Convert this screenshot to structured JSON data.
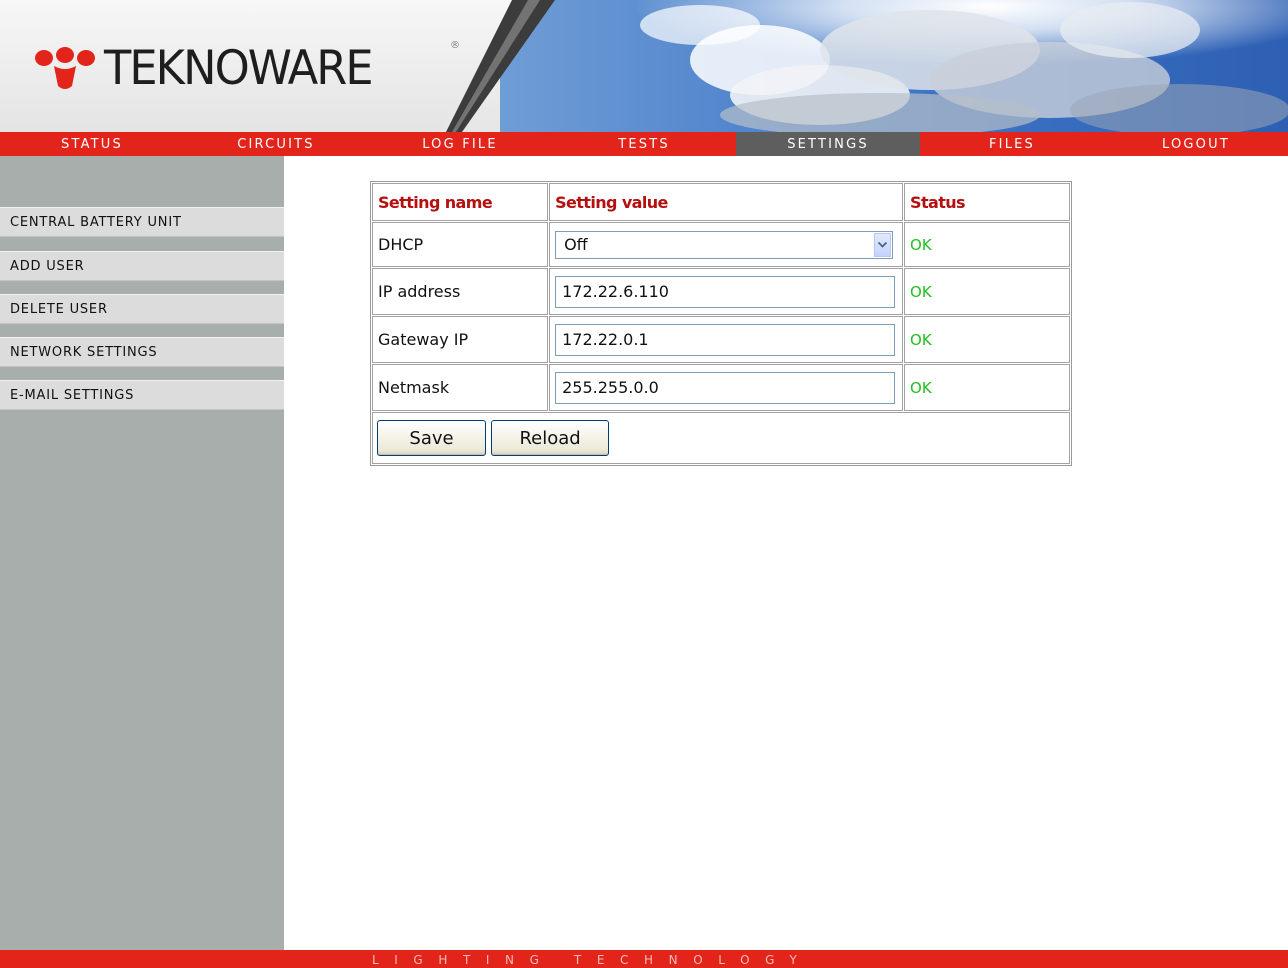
{
  "brand": {
    "logo_text": "TEKNOWARE",
    "registered_mark": "®",
    "footer_tagline": "LIGHTING TECHNOLOGY",
    "accent_color": "#e3241b",
    "active_tab_color": "#5e5e5e"
  },
  "nav": {
    "items": [
      {
        "label": "STATUS"
      },
      {
        "label": "CIRCUITS"
      },
      {
        "label": "LOG FILE"
      },
      {
        "label": "TESTS"
      },
      {
        "label": "SETTINGS"
      },
      {
        "label": "FILES"
      },
      {
        "label": "LOGOUT"
      }
    ],
    "active": "SETTINGS"
  },
  "sidebar": {
    "items": [
      {
        "label": "CENTRAL BATTERY UNIT"
      },
      {
        "label": "ADD USER"
      },
      {
        "label": "DELETE USER"
      },
      {
        "label": "NETWORK SETTINGS"
      },
      {
        "label": "E-MAIL SETTINGS"
      }
    ]
  },
  "settings": {
    "headers": {
      "name": "Setting name",
      "value": "Setting value",
      "status": "Status"
    },
    "rows": [
      {
        "name": "DHCP",
        "value": "Off",
        "status": "OK",
        "control": "select"
      },
      {
        "name": "IP address",
        "value": "172.22.6.110",
        "status": "OK",
        "control": "text"
      },
      {
        "name": "Gateway IP",
        "value": "172.22.0.1",
        "status": "OK",
        "control": "text"
      },
      {
        "name": "Netmask",
        "value": "255.255.0.0",
        "status": "OK",
        "control": "text"
      }
    ],
    "status_ok_color": "#1fbf1f"
  },
  "actions": {
    "save_label": "Save",
    "reload_label": "Reload"
  }
}
